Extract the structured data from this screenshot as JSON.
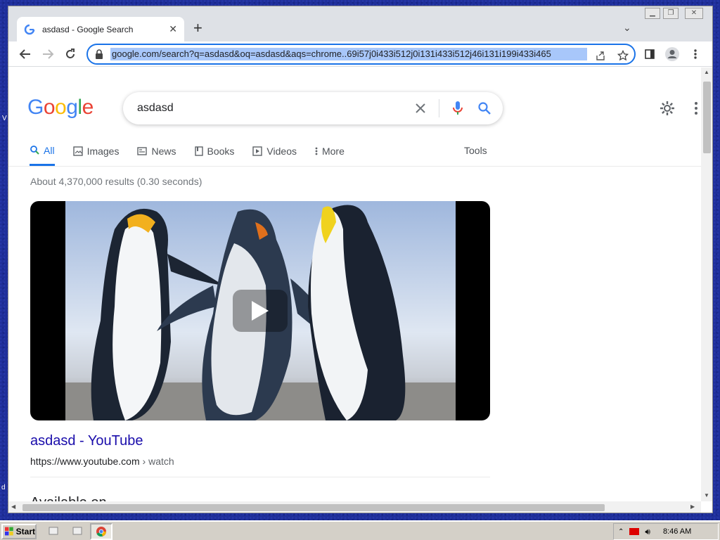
{
  "browser": {
    "tab_title": "asdasd - Google Search",
    "url": "google.com/search?q=asdasd&oq=asdasd&aqs=chrome..69i57j0i433i512j0i131i433i512j46i131i199i433i465"
  },
  "google": {
    "logo_letters": [
      "G",
      "o",
      "o",
      "g",
      "l",
      "e"
    ],
    "logo_colors": [
      "#4285f4",
      "#ea4335",
      "#fbbc05",
      "#4285f4",
      "#34a853",
      "#ea4335"
    ],
    "query": "asdasd",
    "tabs": [
      {
        "label": "All",
        "icon": "search-icon",
        "active": true
      },
      {
        "label": "Images",
        "icon": "image-icon",
        "active": false
      },
      {
        "label": "News",
        "icon": "news-icon",
        "active": false
      },
      {
        "label": "Books",
        "icon": "book-icon",
        "active": false
      },
      {
        "label": "Videos",
        "icon": "video-icon",
        "active": false
      },
      {
        "label": "More",
        "icon": "more-dots-icon",
        "active": false
      }
    ],
    "tools_label": "Tools",
    "result_stats": "About 4,370,000 results (0.30 seconds)",
    "result": {
      "title": "asdasd - YouTube",
      "url": "https://www.youtube.com",
      "breadcrumb": " › watch"
    },
    "next_section": "Available on"
  },
  "taskbar": {
    "start_label": "Start",
    "clock": "8:46 AM"
  },
  "colors": {
    "accent": "#1a73e8",
    "link": "#1a0dab"
  }
}
